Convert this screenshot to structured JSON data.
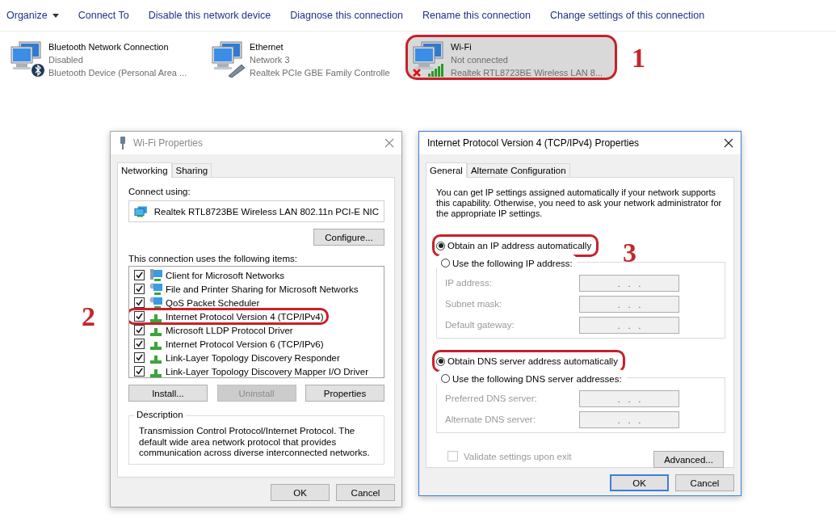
{
  "toolbar": [
    {
      "label": "Organize",
      "kind": "menu"
    },
    {
      "label": "Connect To",
      "kind": "button"
    },
    {
      "label": "Disable this network device",
      "kind": "button"
    },
    {
      "label": "Diagnose this connection",
      "kind": "button"
    },
    {
      "label": "Rename this connection",
      "kind": "button"
    },
    {
      "label": "Change settings of this connection",
      "kind": "button"
    }
  ],
  "connections": [
    {
      "name": "Bluetooth Network Connection",
      "status": "Disabled",
      "device": "Bluetooth Device (Personal Area ...",
      "kind": "bluetooth",
      "selected": false,
      "highlighted": false
    },
    {
      "name": "Ethernet",
      "status": "Network  3",
      "device": "Realtek PCIe GBE Family Controlle",
      "kind": "ethernet",
      "selected": false,
      "highlighted": false
    },
    {
      "name": "Wi-Fi",
      "status": "Not connected",
      "device": "Realtek RTL8723BE Wireless LAN 8...",
      "kind": "wifi",
      "selected": true,
      "highlighted": true
    }
  ],
  "annotations": [
    {
      "label": "1",
      "kind": "connection"
    },
    {
      "label": "2",
      "kind": "item"
    },
    {
      "label": "3",
      "kind": "radio"
    }
  ],
  "wifi_dialog": {
    "title": "Wi-Fi Properties",
    "active": false,
    "tabs": [
      {
        "label": "Networking",
        "selected": true
      },
      {
        "label": "Sharing",
        "selected": false
      }
    ],
    "connect_using_label": "Connect using:",
    "adapter": "Realtek RTL8723BE Wireless LAN 802.11n PCI-E NIC",
    "configure_button": "Configure...",
    "items_label": "This connection uses the following items:",
    "items": [
      {
        "label": "Client for Microsoft Networks",
        "checked": true,
        "kind": "client",
        "highlighted": false
      },
      {
        "label": "File and Printer Sharing for Microsoft Networks",
        "checked": true,
        "kind": "service",
        "highlighted": false
      },
      {
        "label": "QoS Packet Scheduler",
        "checked": true,
        "kind": "service",
        "highlighted": false
      },
      {
        "label": "Internet Protocol Version 4 (TCP/IPv4)",
        "checked": true,
        "kind": "protocol",
        "highlighted": true
      },
      {
        "label": "Microsoft LLDP Protocol Driver",
        "checked": true,
        "kind": "protocol",
        "highlighted": false
      },
      {
        "label": "Internet Protocol Version 6 (TCP/IPv6)",
        "checked": true,
        "kind": "protocol",
        "highlighted": false
      },
      {
        "label": "Link-Layer Topology Discovery Responder",
        "checked": true,
        "kind": "protocol",
        "highlighted": false
      },
      {
        "label": "Link-Layer Topology Discovery Mapper I/O Driver",
        "checked": true,
        "kind": "protocol",
        "highlighted": false
      }
    ],
    "item_buttons": [
      {
        "label": "Install...",
        "disabled": false
      },
      {
        "label": "Uninstall",
        "disabled": true
      },
      {
        "label": "Properties",
        "disabled": false
      }
    ],
    "description": {
      "title": "Description",
      "text": "Transmission Control Protocol/Internet Protocol. The default wide area network protocol that provides communication across diverse interconnected networks."
    },
    "footer_buttons": [
      {
        "label": "OK",
        "default": false
      },
      {
        "label": "Cancel",
        "default": false
      }
    ]
  },
  "ipv4_dialog": {
    "title": "Internet Protocol Version 4 (TCP/IPv4) Properties",
    "active": true,
    "tabs": [
      {
        "label": "General",
        "selected": true
      },
      {
        "label": "Alternate Configuration",
        "selected": false
      }
    ],
    "intro": "You can get IP settings assigned automatically if your network supports this capability. Otherwise, you need to ask your network administrator for the appropriate IP settings.",
    "sections": [
      {
        "auto_option": {
          "label": "Obtain an IP address automatically",
          "selected": true,
          "highlighted": true
        },
        "manual_option": {
          "label": "Use the following IP address:",
          "selected": false
        },
        "fields": [
          {
            "label": "IP address:",
            "value": ".   .   .",
            "disabled": true
          },
          {
            "label": "Subnet mask:",
            "value": ".   .   .",
            "disabled": true
          },
          {
            "label": "Default gateway:",
            "value": ".   .   .",
            "disabled": true
          }
        ]
      },
      {
        "auto_option": {
          "label": "Obtain DNS server address automatically",
          "selected": true,
          "highlighted": true
        },
        "manual_option": {
          "label": "Use the following DNS server addresses:",
          "selected": false
        },
        "fields": [
          {
            "label": "Preferred DNS server:",
            "value": ".   .   .",
            "disabled": true
          },
          {
            "label": "Alternate DNS server:",
            "value": ".   .   .",
            "disabled": true
          }
        ]
      }
    ],
    "validate": {
      "label": "Validate settings upon exit",
      "checked": false,
      "disabled": true
    },
    "advanced_button": "Advanced...",
    "footer_buttons": [
      {
        "label": "OK",
        "default": true
      },
      {
        "label": "Cancel",
        "default": false
      }
    ]
  }
}
